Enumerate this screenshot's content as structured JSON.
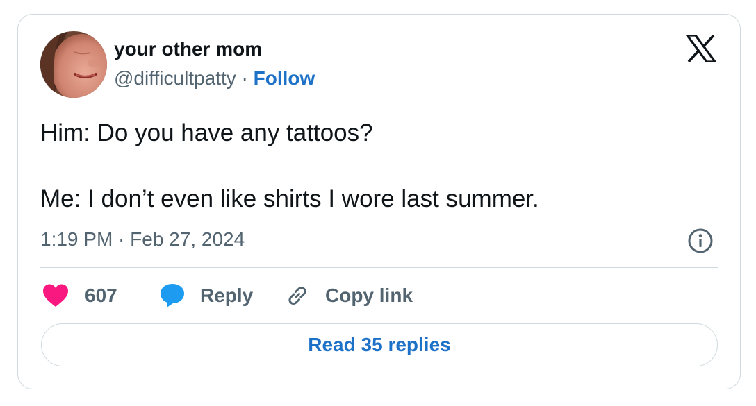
{
  "author": {
    "display_name": "your other mom",
    "handle": "@difficultpatty",
    "separator": " · ",
    "follow_label": "Follow"
  },
  "tweet": {
    "lines": [
      "Him: Do you have any tattoos?",
      "Me: I don’t even like shirts I wore last summer."
    ],
    "timestamp": "1:19 PM · Feb 27, 2024"
  },
  "actions": {
    "like_count": "607",
    "reply_label": "Reply",
    "copy_link_label": "Copy link"
  },
  "footer": {
    "read_replies_label": "Read 35 replies"
  },
  "icons": {
    "brand": "x-logo-icon",
    "info": "info-icon",
    "like": "heart-icon",
    "reply": "speech-bubble-icon",
    "copy": "link-icon"
  },
  "colors": {
    "text": "#0f1419",
    "secondary_text": "#536471",
    "link": "#1d72c8",
    "heart": "#f91880",
    "reply_bubble": "#1d9bf0",
    "border": "#cfd9de"
  }
}
